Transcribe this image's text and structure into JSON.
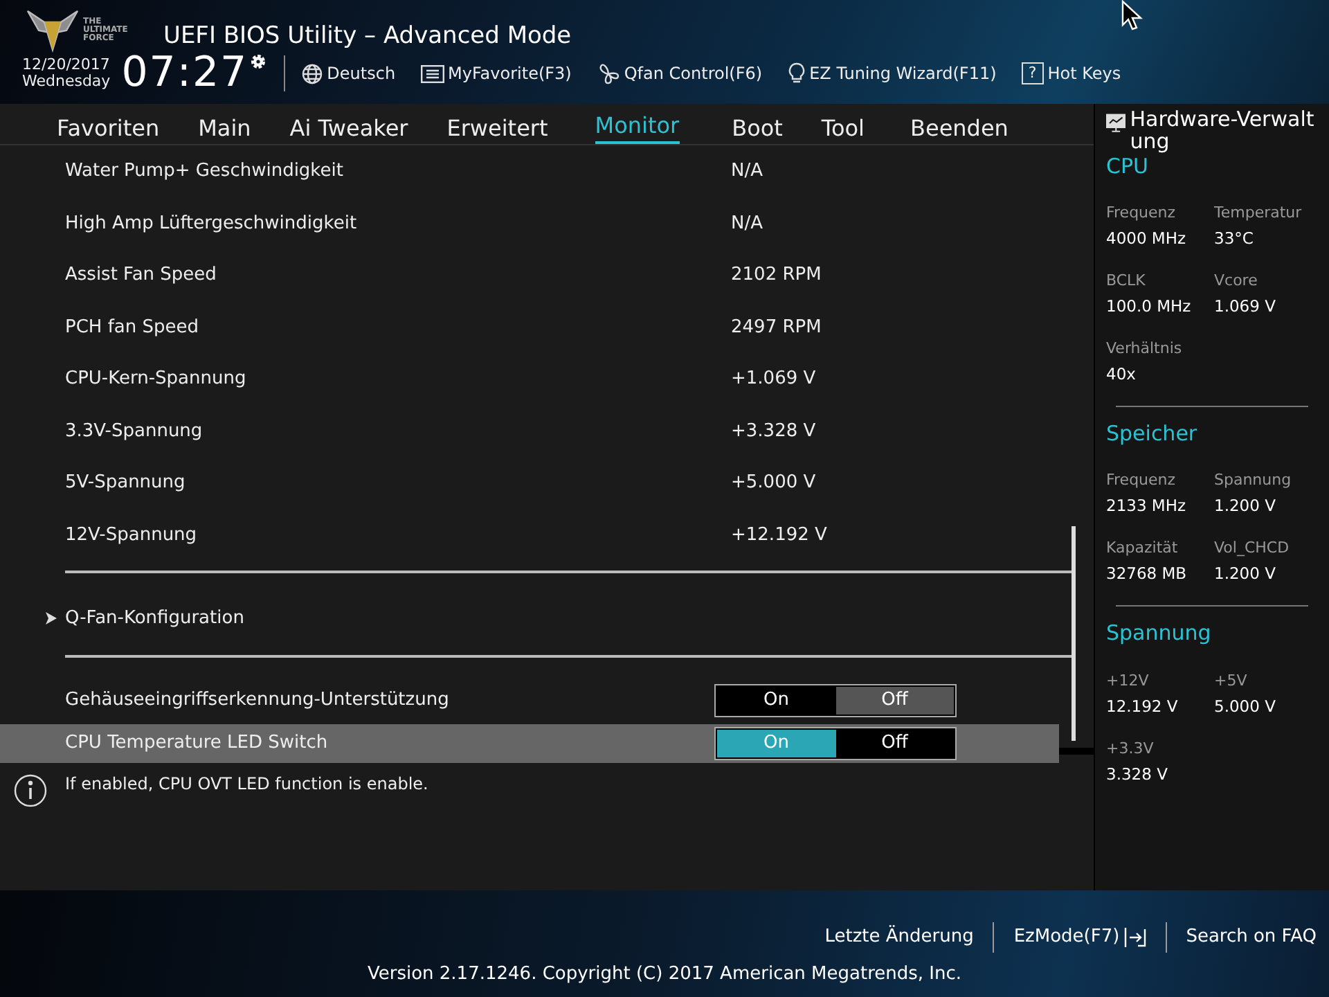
{
  "header": {
    "logo_text": [
      "THE",
      "ULTIMATE",
      "FORCE"
    ],
    "title": "UEFI BIOS Utility – Advanced Mode",
    "date": "12/20/2017",
    "weekday": "Wednesday",
    "time": "07:27",
    "tools": [
      {
        "kind": "globe",
        "label": "Deutsch"
      },
      {
        "kind": "favorite",
        "label": "MyFavorite(F3)"
      },
      {
        "kind": "fan",
        "label": "Qfan Control(F6)"
      },
      {
        "kind": "bulb",
        "label": "EZ Tuning Wizard(F11)"
      },
      {
        "kind": "help",
        "icon": "?",
        "label": "Hot Keys"
      }
    ]
  },
  "tabs": [
    {
      "label": "Favoriten",
      "selected": false
    },
    {
      "label": "Main",
      "selected": false
    },
    {
      "label": "Ai Tweaker",
      "selected": false
    },
    {
      "label": "Erweitert",
      "selected": false
    },
    {
      "label": "Monitor",
      "selected": true
    },
    {
      "label": "Boot",
      "selected": false
    },
    {
      "label": "Tool",
      "selected": false
    },
    {
      "label": "Beenden",
      "selected": false
    }
  ],
  "settings": [
    {
      "kind": "reading",
      "label": "Water Pump+ Geschwindigkeit",
      "value": "N/A"
    },
    {
      "kind": "reading",
      "label": "High Amp Lüftergeschwindigkeit",
      "value": "N/A"
    },
    {
      "kind": "reading",
      "label": "Assist Fan Speed",
      "value": "2102 RPM"
    },
    {
      "kind": "reading",
      "label": "PCH fan Speed",
      "value": "2497 RPM"
    },
    {
      "kind": "reading",
      "label": "CPU-Kern-Spannung",
      "value": "+1.069 V"
    },
    {
      "kind": "reading",
      "label": "3.3V-Spannung",
      "value": "+3.328 V"
    },
    {
      "kind": "reading",
      "label": "5V-Spannung",
      "value": "+5.000 V"
    },
    {
      "kind": "reading",
      "label": "12V-Spannung",
      "value": "+12.192 V"
    },
    {
      "kind": "divider"
    },
    {
      "kind": "submenu",
      "label": "Q-Fan-Konfiguration"
    },
    {
      "kind": "divider"
    },
    {
      "kind": "toggle",
      "label": "Gehäuseeingriffserkennung-Unterstützung",
      "selected": false,
      "options": [
        {
          "label": "On",
          "selected": false
        },
        {
          "label": "Off",
          "selected": true
        }
      ]
    },
    {
      "kind": "toggle",
      "label": "CPU Temperature LED Switch",
      "selected": true,
      "options": [
        {
          "label": "On",
          "selected": true
        },
        {
          "label": "Off",
          "selected": false
        }
      ]
    }
  ],
  "help_text": "If enabled, CPU OVT LED function is enable.",
  "hardware_monitor": {
    "title": "Hardware-Verwaltung",
    "sections": [
      {
        "title": "CPU",
        "items": [
          {
            "label": "Frequenz",
            "value": "4000 MHz"
          },
          {
            "label": "Temperatur",
            "value": "33°C"
          },
          {
            "label": "BCLK",
            "value": "100.0 MHz"
          },
          {
            "label": "Vcore",
            "value": "1.069 V"
          },
          {
            "label": "Verhältnis",
            "value": "40x"
          }
        ]
      },
      {
        "title": "Speicher",
        "items": [
          {
            "label": "Frequenz",
            "value": "2133 MHz"
          },
          {
            "label": "Spannung",
            "value": "1.200 V"
          },
          {
            "label": "Kapazität",
            "value": "32768 MB"
          },
          {
            "label": "Vol_CHCD",
            "value": "1.200 V"
          }
        ]
      },
      {
        "title": "Spannung",
        "items": [
          {
            "label": "+12V",
            "value": "12.192 V"
          },
          {
            "label": "+5V",
            "value": "5.000 V"
          },
          {
            "label": "+3.3V",
            "value": "3.328 V"
          }
        ]
      }
    ]
  },
  "footer": {
    "links": [
      {
        "kind": "text",
        "label": "Letzte Änderung"
      },
      {
        "kind": "exit",
        "label": "EzMode(F7)"
      },
      {
        "kind": "text",
        "label": "Search on FAQ"
      }
    ],
    "version": "Version 2.17.1246. Copyright (C) 2017 American Megatrends, Inc."
  }
}
